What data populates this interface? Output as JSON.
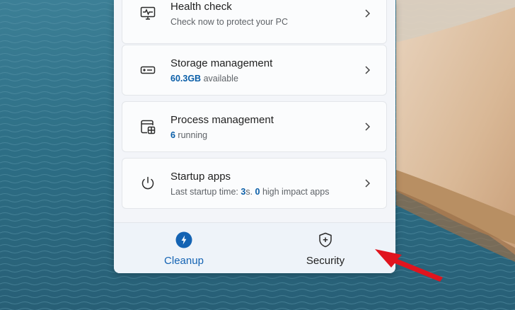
{
  "cards": [
    {
      "title": "Health check",
      "subtitle": "Check now to protect your PC",
      "icon": "health-monitor-icon"
    },
    {
      "title": "Storage management",
      "value": "60.3GB",
      "subtitle_suffix": " available",
      "icon": "storage-drive-icon"
    },
    {
      "title": "Process management",
      "value": "6",
      "subtitle_suffix": " running",
      "icon": "process-windows-icon"
    },
    {
      "title": "Startup apps",
      "prefix": "Last startup time: ",
      "time_value": "3",
      "time_unit": "s. ",
      "impact_value": "0",
      "impact_suffix": " high impact apps",
      "icon": "power-icon"
    }
  ],
  "nav": {
    "cleanup_label": "Cleanup",
    "security_label": "Security"
  },
  "colors": {
    "accent": "#0a5ea8",
    "cleanup_active": "#1463b3",
    "arrow": "#e0141e"
  }
}
